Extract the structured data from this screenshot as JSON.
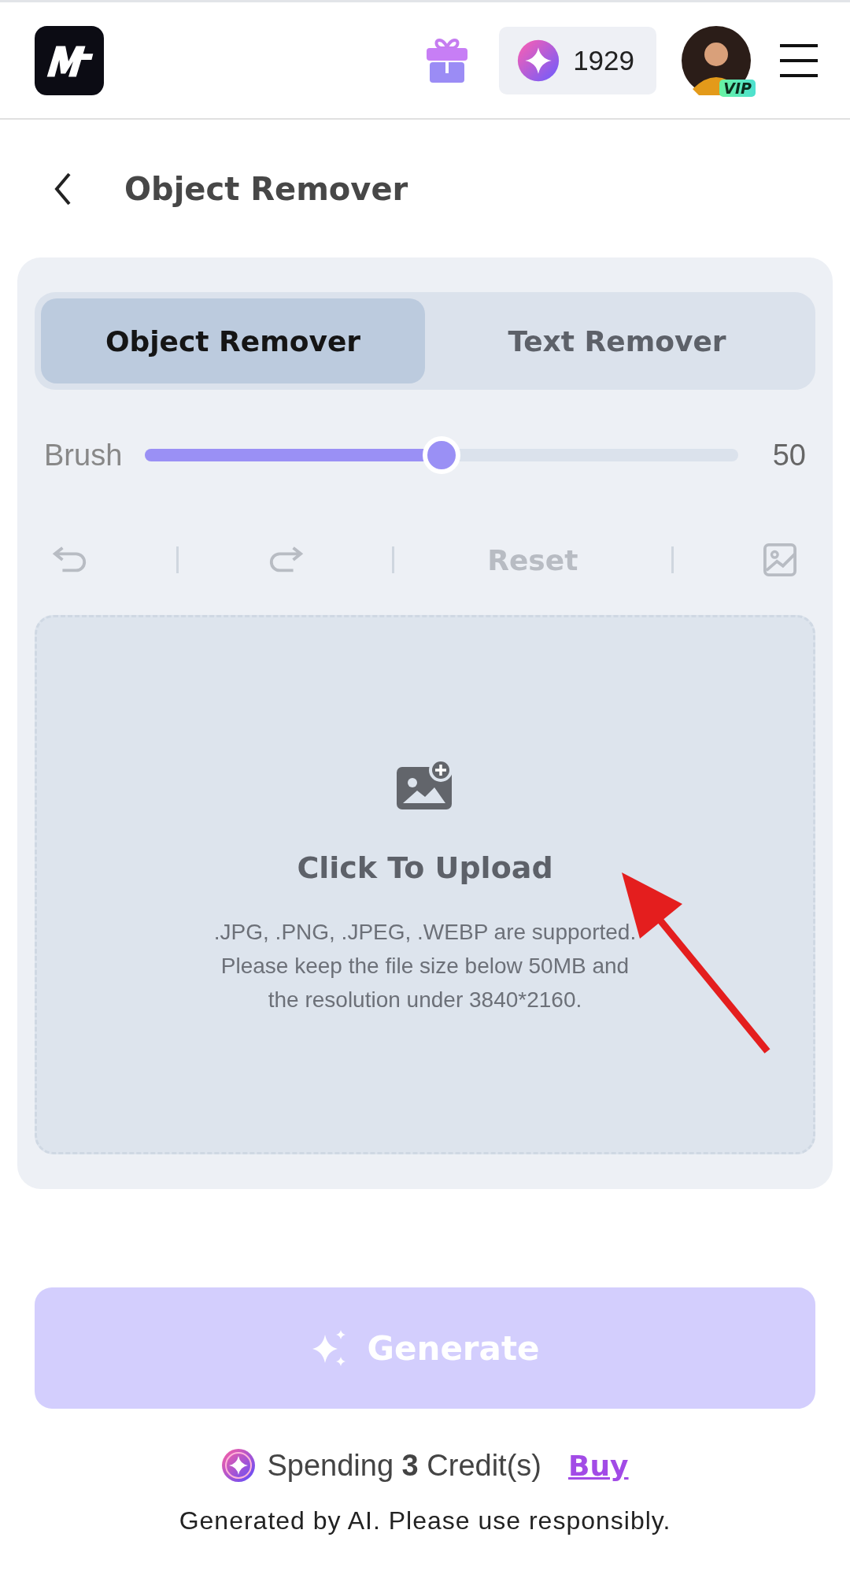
{
  "header": {
    "credits": "1929",
    "avatar_badge": "VIP"
  },
  "page_title": "Object Remover",
  "tabs": [
    {
      "label": "Object Remover",
      "selected": true
    },
    {
      "label": "Text Remover",
      "selected": false
    }
  ],
  "brush": {
    "label": "Brush",
    "level": 0.5,
    "reading": "50"
  },
  "toolbar": {
    "reset": "Reset",
    "disabled": true
  },
  "upload": {
    "title": "Click To Upload",
    "lines": [
      ".JPG, .PNG, .JPEG, .WEBP are supported.",
      "Please keep the file size below 50MB and",
      "the resolution under 3840*2160."
    ]
  },
  "generate": {
    "label": "Generate",
    "disabled": true
  },
  "cost": {
    "text": "Spending **3** Credit(s)",
    "link": "Buy"
  },
  "footer": "Generated by AI. Please use responsibly."
}
